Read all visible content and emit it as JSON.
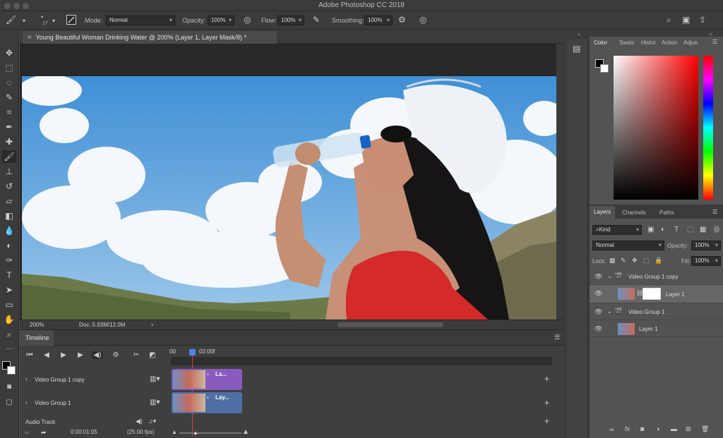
{
  "window": {
    "title": "Adobe Photoshop CC 2018"
  },
  "options": {
    "brush_size": "17",
    "mode_label": "Mode:",
    "mode_value": "Normal",
    "opacity_label": "Opacity:",
    "opacity_value": "100%",
    "flow_label": "Flow:",
    "flow_value": "100%",
    "smoothing_label": "Smoothing:",
    "smoothing_value": "100%"
  },
  "document": {
    "tab_title": "Young Beautiful Woman Drinking Water @ 200% (Layer 1, Layer Mask/8) *",
    "zoom": "200%",
    "doc_info": "Doc: 5.93M/12.0M"
  },
  "timeline": {
    "title": "Timeline",
    "start_time": "00",
    "marker_time": "02:00f",
    "current_time": "0:00:01:05",
    "fps": "(25.00 fps)",
    "tracks": [
      {
        "name": "Video Group 1 copy",
        "clip_label": "La..."
      },
      {
        "name": "Video Group 1",
        "clip_label": "Lay..."
      }
    ],
    "audio_track": "Audio Track"
  },
  "color_panel": {
    "tabs": [
      "Color",
      "Swatc",
      "Histor",
      "Action",
      "Adjus"
    ]
  },
  "layers_panel": {
    "tabs": [
      "Layers",
      "Channels",
      "Paths"
    ],
    "kind_filter": "Kind",
    "blend_mode": "Normal",
    "opacity_label": "Opacity:",
    "opacity_value": "100%",
    "lock_label": "Lock:",
    "fill_label": "Fill:",
    "fill_value": "100%",
    "layers": [
      {
        "name": "Video Group 1 copy",
        "type": "group"
      },
      {
        "name": "Layer 1",
        "type": "layer-with-mask"
      },
      {
        "name": "Video Group 1",
        "type": "group"
      },
      {
        "name": "Layer 1",
        "type": "layer"
      }
    ]
  },
  "colors": {
    "purple_clip": "#8a5bbf",
    "blue_clip": "#4e6fa3",
    "playhead": "#e03a3a",
    "selected_row": "#666666"
  }
}
